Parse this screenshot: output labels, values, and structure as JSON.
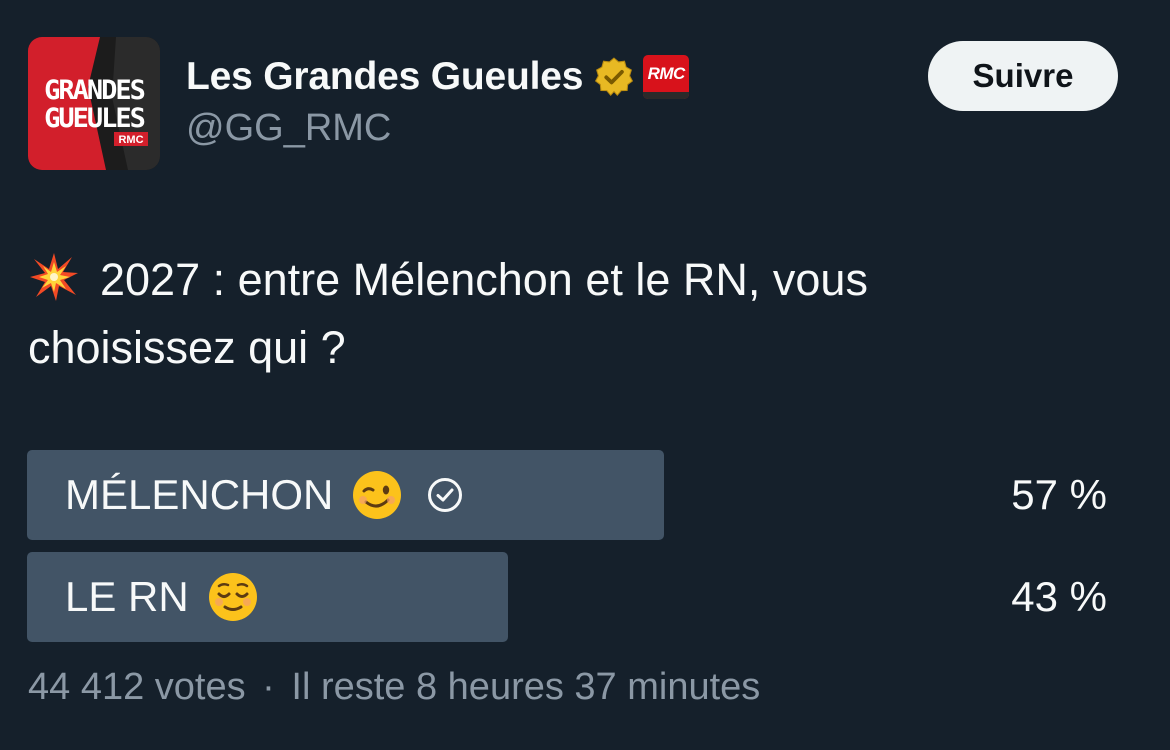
{
  "account": {
    "display_name": "Les Grandes Gueules",
    "handle": "@GG_RMC",
    "follow_label": "Suivre",
    "avatar_text": "LES GRANDES GUEULES",
    "avatar_badge": "RMC",
    "affiliate_badge": "RMC",
    "verified_icon": "gold-verified-badge-icon"
  },
  "tweet": {
    "leading_icon": "collision-emoji-icon",
    "text": "2027 : entre Mélenchon et le RN, vous choisissez qui ?"
  },
  "poll": {
    "options": [
      {
        "label": "MÉLENCHON",
        "emoji": "winking-face-emoji-icon",
        "percent": 57,
        "percent_label": "57 %",
        "selected": true
      },
      {
        "label": "LE RN",
        "emoji": "relieved-face-emoji-icon",
        "percent": 43,
        "percent_label": "43 %",
        "selected": false
      }
    ],
    "votes": "44 412 votes",
    "separator": "·",
    "time_left": "Il reste 8 heures 37 minutes"
  },
  "colors": {
    "background": "#15202b",
    "bar_fill": "#425466",
    "muted_text": "#8b98a5",
    "verified_gold": "#e8b923",
    "rmc_red": "#d8121b"
  }
}
